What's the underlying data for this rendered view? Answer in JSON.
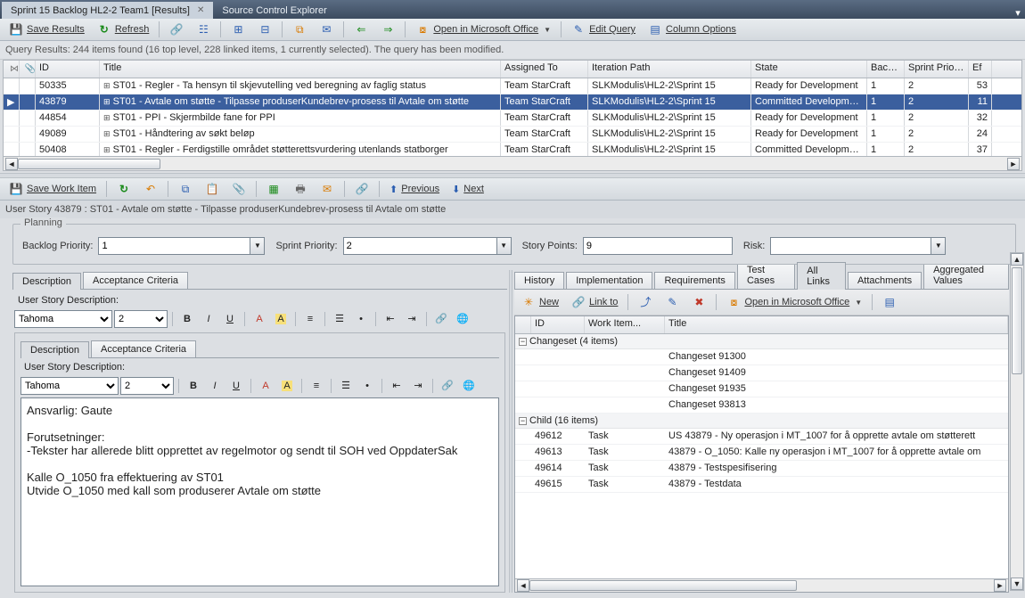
{
  "topTabs": {
    "active": "Sprint 15 Backlog HL2-2 Team1 [Results]",
    "others": [
      "Source Control Explorer"
    ]
  },
  "toolbar1": {
    "saveResults": "Save Results",
    "refresh": "Refresh",
    "openOffice": "Open in Microsoft Office",
    "editQuery": "Edit Query",
    "columnOptions": "Column Options"
  },
  "queryStatus": "Query Results: 244 items found (16 top level, 228 linked items, 1 currently selected). The query has been modified.",
  "gridHeaders": [
    "",
    "",
    "ID",
    "Title",
    "Assigned To",
    "Iteration Path",
    "State",
    "Back...",
    "Sprint Priority",
    "Ef"
  ],
  "gridRows": [
    {
      "id": "50335",
      "title": "ST01 - Regler - Ta hensyn til skjevutelling ved beregning av faglig status",
      "assigned": "Team StarCraft",
      "iter": "SLKModulis\\HL2-2\\Sprint 15",
      "state": "Ready for Development",
      "back": "1",
      "sp": "2",
      "ef": "53",
      "selected": false
    },
    {
      "id": "43879",
      "title": "ST01 - Avtale om støtte - Tilpasse produserKundebrev-prosess til Avtale om støtte",
      "assigned": "Team StarCraft",
      "iter": "SLKModulis\\HL2-2\\Sprint 15",
      "state": "Committed Development",
      "back": "1",
      "sp": "2",
      "ef": "11",
      "selected": true
    },
    {
      "id": "44854",
      "title": "ST01 - PPI - Skjermbilde fane for PPI",
      "assigned": "Team StarCraft",
      "iter": "SLKModulis\\HL2-2\\Sprint 15",
      "state": "Ready for Development",
      "back": "1",
      "sp": "2",
      "ef": "32",
      "selected": false
    },
    {
      "id": "49089",
      "title": "ST01 - Håndtering av søkt beløp",
      "assigned": "Team StarCraft",
      "iter": "SLKModulis\\HL2-2\\Sprint 15",
      "state": "Ready for Development",
      "back": "1",
      "sp": "2",
      "ef": "24",
      "selected": false
    },
    {
      "id": "50408",
      "title": "ST01 - Regler - Ferdigstille området støtterettsvurdering utenlands statborger",
      "assigned": "Team StarCraft",
      "iter": "SLKModulis\\HL2-2\\Sprint 15",
      "state": "Committed Development",
      "back": "1",
      "sp": "2",
      "ef": "37",
      "selected": false
    }
  ],
  "toolbar2": {
    "saveWorkItem": "Save Work Item",
    "previous": "Previous",
    "next": "Next"
  },
  "workItemTitle": "User Story 43879 : ST01 - Avtale om støtte - Tilpasse produserKundebrev-prosess til Avtale om støtte",
  "planning": {
    "legend": "Planning",
    "backlogPriorityLabel": "Backlog Priority:",
    "backlogPriority": "1",
    "sprintPriorityLabel": "Sprint Priority:",
    "sprintPriority": "2",
    "storyPointsLabel": "Story Points:",
    "storyPoints": "9",
    "riskLabel": "Risk:",
    "risk": ""
  },
  "leftTabs": {
    "description": "Description",
    "acceptance": "Acceptance Criteria",
    "userStoryDescLabel": "User Story Description:",
    "font": "Tahoma",
    "size": "2"
  },
  "descriptionLines": [
    "Ansvarlig: Gaute",
    "",
    "Forutsetninger:",
    "-Tekster har allerede blitt opprettet av regelmotor og sendt til SOH ved OppdaterSak",
    "",
    "Kalle O_1050 fra effektuering av ST01",
    "Utvide O_1050 med kall som produserer Avtale om støtte"
  ],
  "rightTabs": [
    "History",
    "Implementation",
    "Requirements",
    "Test Cases",
    "All Links",
    "Attachments",
    "Aggregated Values"
  ],
  "rightTabsActive": "All Links",
  "linkBar": {
    "new": "New",
    "linkTo": "Link to",
    "openOffice": "Open in Microsoft Office"
  },
  "linkHeaders": [
    "",
    "ID",
    "Work Item...",
    "Title"
  ],
  "linkGroups": [
    {
      "name": "Changeset (4 items)",
      "rows": [
        {
          "id": "",
          "type": "",
          "title": "Changeset 91300"
        },
        {
          "id": "",
          "type": "",
          "title": "Changeset 91409"
        },
        {
          "id": "",
          "type": "",
          "title": "Changeset 91935"
        },
        {
          "id": "",
          "type": "",
          "title": "Changeset 93813"
        }
      ]
    },
    {
      "name": "Child (16 items)",
      "rows": [
        {
          "id": "49612",
          "type": "Task",
          "title": "US 43879 - Ny operasjon i MT_1007 for å opprette avtale om støtterett"
        },
        {
          "id": "49613",
          "type": "Task",
          "title": "43879 - O_1050: Kalle ny operasjon i MT_1007 for å opprette avtale om"
        },
        {
          "id": "49614",
          "type": "Task",
          "title": "43879 - Testspesifisering"
        },
        {
          "id": "49615",
          "type": "Task",
          "title": "43879 - Testdata"
        }
      ]
    }
  ]
}
